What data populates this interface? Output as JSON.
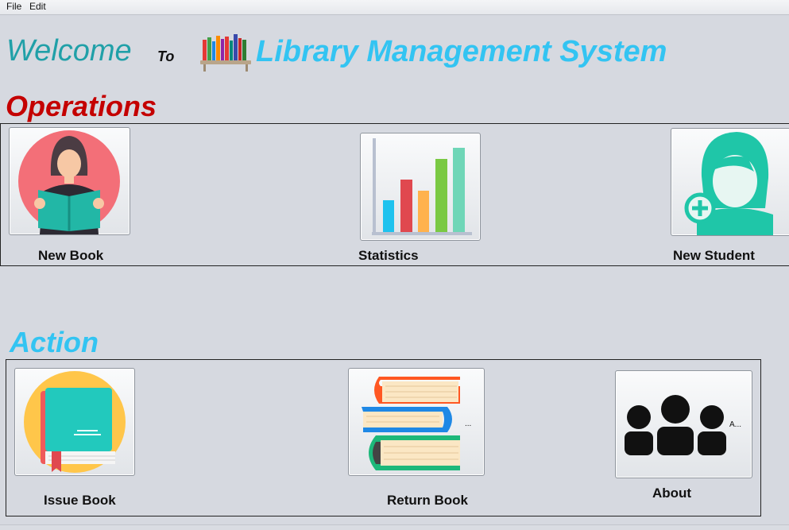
{
  "menubar": {
    "items": [
      "File",
      "Edit"
    ]
  },
  "header": {
    "welcome": "Welcome",
    "to": "To",
    "title": "Library Management System"
  },
  "operations": {
    "title": "Operations",
    "tiles": [
      {
        "label": "New Book",
        "icon": "reading-woman-icon"
      },
      {
        "label": "Statistics",
        "icon": "bar-chart-icon"
      },
      {
        "label": "New Student",
        "icon": "add-student-icon"
      }
    ]
  },
  "action": {
    "title": "Action",
    "tiles": [
      {
        "label": "Issue Book",
        "icon": "book-icon"
      },
      {
        "label": "Return Book",
        "icon": "book-stack-icon",
        "suffix": "..."
      },
      {
        "label": "About",
        "icon": "group-icon",
        "suffix": "A..."
      }
    ]
  },
  "colors": {
    "welcome": "#20a0a8",
    "title": "#33c4f2",
    "operations_title": "#c40000",
    "action_title": "#33c4f2",
    "background": "#d6d9e0"
  }
}
